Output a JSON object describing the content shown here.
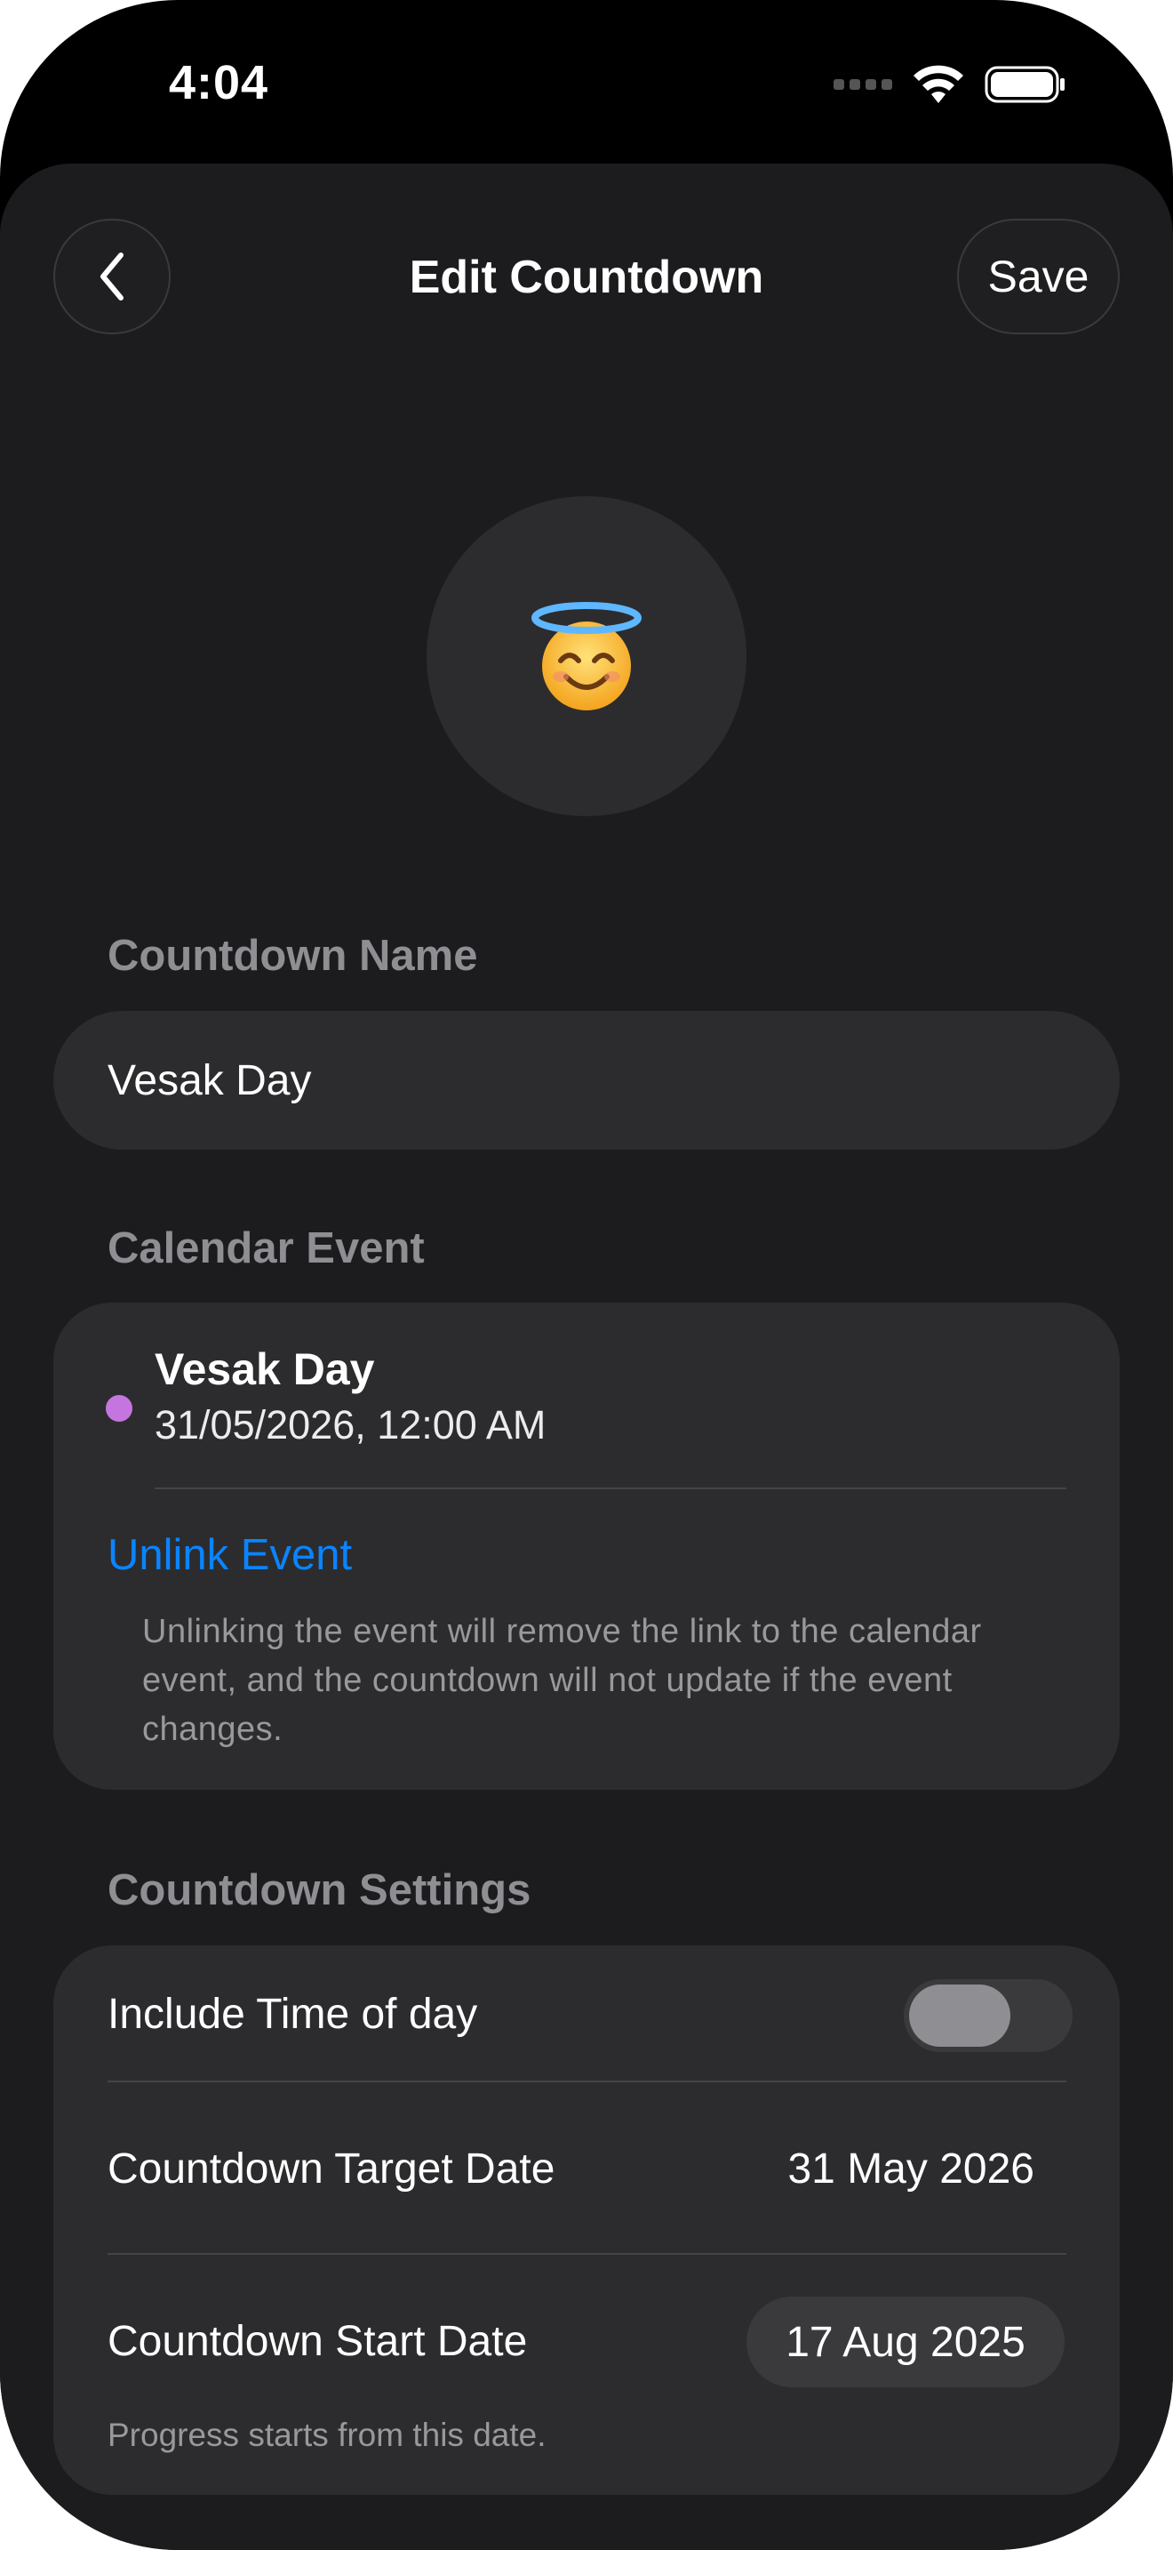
{
  "status_bar": {
    "time": "4:04"
  },
  "nav": {
    "title": "Edit Countdown",
    "save_label": "Save"
  },
  "emoji": "😇",
  "name_section": {
    "label": "Countdown Name",
    "value": "Vesak Day"
  },
  "calendar_section": {
    "label": "Calendar Event",
    "event_title": "Vesak Day",
    "event_datetime": "31/05/2026, 12:00 AM",
    "event_color": "#c575e0",
    "unlink_label": "Unlink Event",
    "unlink_note": "Unlinking the event will remove the link to the calendar event, and the countdown will not update if the event changes."
  },
  "settings_section": {
    "label": "Countdown Settings",
    "include_time_label": "Include Time of day",
    "include_time_on": false,
    "target_date_label": "Countdown Target Date",
    "target_date_value": "31 May 2026",
    "start_date_label": "Countdown Start Date",
    "start_date_value": "17 Aug 2025",
    "start_note": "Progress starts from this date."
  },
  "colors": {
    "accent": "#0a84ff",
    "background": "#1c1c1e",
    "card": "#2c2c2e"
  }
}
